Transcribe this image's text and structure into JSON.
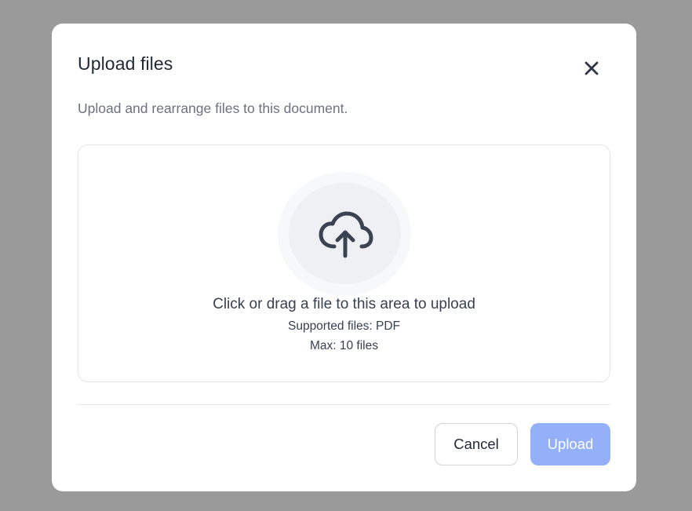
{
  "dialog": {
    "title": "Upload files",
    "subtitle": "Upload and rearrange files to this document.",
    "close_icon": "close-icon"
  },
  "dropzone": {
    "icon": "cloud-upload-icon",
    "main_text": "Click or drag a file to this area to upload",
    "supported_text": "Supported files: PDF",
    "max_text": "Max: 10 files"
  },
  "actions": {
    "cancel_label": "Cancel",
    "upload_label": "Upload",
    "upload_enabled": false
  },
  "colors": {
    "overlay": "#9a9a9a",
    "primary_disabled": "#93b0f9",
    "text_primary": "#1f2937",
    "text_secondary": "#6b7280",
    "icon": "#3b4252"
  }
}
